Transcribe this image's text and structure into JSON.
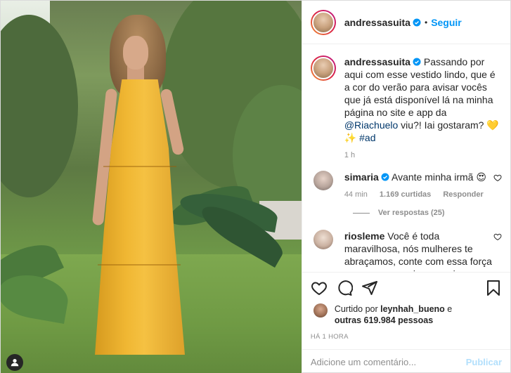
{
  "post": {
    "author": "andressasuita",
    "follow_label": "Seguir",
    "dot": "•"
  },
  "caption": {
    "author": "andressasuita",
    "text_1": "Passando por aqui com esse vestido lindo, que é a cor do verão para avisar vocês que já está disponível lá na minha página no site e app da ",
    "mention": "@Riachuelo",
    "text_2": " viu?! Iai gostaram? 💛 ✨ ",
    "hashtag": "#ad",
    "time": "1 h"
  },
  "comments": [
    {
      "author": "simaria",
      "text": "Avante minha irmã 😍",
      "time": "44 min",
      "likes": "1.169 curtidas",
      "reply_label": "Responder",
      "replies_label": "Ver respostas (25)"
    },
    {
      "author": "riosleme",
      "text": "Você é toda maravilhosa, nós mulheres te abraçamos, conte com essa força para o que precisar, amei seu"
    }
  ],
  "likes": {
    "prefix": "Curtido por ",
    "user": "leynhah_bueno",
    "middle": " e",
    "others": "outras 619.984 pessoas"
  },
  "posted_ago": "HÁ 1 HORA",
  "comment_box": {
    "placeholder": "Adicione um comentário...",
    "publish_label": "Publicar"
  },
  "icons": {
    "like": "heart-icon",
    "comment": "comment-icon",
    "share": "share-icon",
    "save": "bookmark-icon",
    "verified": "verified-badge-icon",
    "tag": "user-tag-icon"
  },
  "colors": {
    "link": "#0095f6",
    "mention": "#00376b",
    "muted": "#8e8e8e",
    "text": "#262626",
    "publish_disabled": "#b2dffc",
    "dress": "#f0b733"
  }
}
